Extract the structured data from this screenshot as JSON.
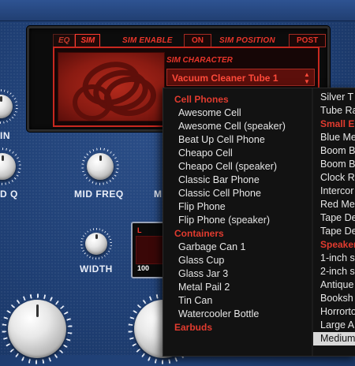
{
  "display": {
    "tabs": [
      {
        "label": "EQ",
        "active": false
      },
      {
        "label": "SIM",
        "active": true
      }
    ],
    "sim_enable_label": "SIM ENABLE",
    "sim_enable_value": "ON",
    "sim_position_label": "SIM POSITION",
    "sim_position_value": "POST",
    "sim_character_label": "SIM CHARACTER",
    "sim_character_value": "Vacuum Cleaner Tube 1",
    "accent_color": "#e8352a"
  },
  "knobs": {
    "partial_left_label": "IN",
    "freq_q_label": "D Q",
    "mid_freq_label": "MID FREQ",
    "partial_right_label": "M",
    "width_label": "WIDTH"
  },
  "meter": {
    "channel": "L",
    "value": "100"
  },
  "menu": {
    "col1": [
      {
        "type": "header",
        "text": "Cell Phones"
      },
      {
        "type": "item",
        "text": "Awesome Cell"
      },
      {
        "type": "item",
        "text": "Awesome Cell (speaker)"
      },
      {
        "type": "item",
        "text": "Beat Up Cell Phone"
      },
      {
        "type": "item",
        "text": "Cheapo Cell"
      },
      {
        "type": "item",
        "text": "Cheapo Cell (speaker)"
      },
      {
        "type": "item",
        "text": "Classic Bar Phone"
      },
      {
        "type": "item",
        "text": "Classic Cell Phone"
      },
      {
        "type": "item",
        "text": "Flip Phone"
      },
      {
        "type": "item",
        "text": "Flip Phone (speaker)"
      },
      {
        "type": "header",
        "text": "Containers"
      },
      {
        "type": "item",
        "text": "Garbage Can 1"
      },
      {
        "type": "item",
        "text": "Glass Cup"
      },
      {
        "type": "item",
        "text": "Glass Jar 3"
      },
      {
        "type": "item",
        "text": "Metal Pail 2"
      },
      {
        "type": "item",
        "text": "Tin Can"
      },
      {
        "type": "item",
        "text": "Watercooler Bottle"
      },
      {
        "type": "header",
        "text": "Earbuds"
      }
    ],
    "col2": [
      {
        "type": "item",
        "text": "Silver T"
      },
      {
        "type": "item",
        "text": "Tube Ra"
      },
      {
        "type": "header",
        "text": "Small E"
      },
      {
        "type": "item",
        "text": "Blue Me"
      },
      {
        "type": "item",
        "text": "Boom B"
      },
      {
        "type": "item",
        "text": "Boom B"
      },
      {
        "type": "item",
        "text": "Clock R"
      },
      {
        "type": "item",
        "text": "Intercor"
      },
      {
        "type": "item",
        "text": "Red Me"
      },
      {
        "type": "item",
        "text": "Tape De"
      },
      {
        "type": "item",
        "text": "Tape De"
      },
      {
        "type": "header",
        "text": "Speaker"
      },
      {
        "type": "item",
        "text": "1-inch s"
      },
      {
        "type": "item",
        "text": "2-inch s"
      },
      {
        "type": "item",
        "text": "Antique"
      },
      {
        "type": "item",
        "text": "Booksh"
      },
      {
        "type": "item",
        "text": "Horrorto"
      },
      {
        "type": "item",
        "text": "Large A"
      },
      {
        "type": "item",
        "text": "Medium",
        "highlighted": true
      }
    ]
  }
}
